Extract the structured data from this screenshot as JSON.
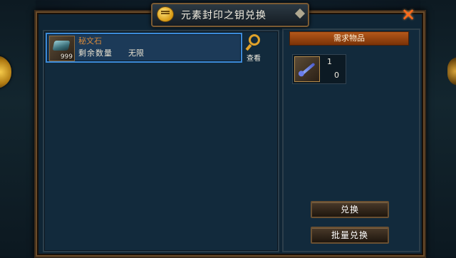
{
  "window": {
    "title": "元素封印之钥兑换",
    "title_icon": "chat-bubble-icon",
    "close_icon": "close-x-icon"
  },
  "exchange_list": [
    {
      "name": "秘文石",
      "count": "999",
      "remain_label": "剩余数量",
      "remain_value": "无限",
      "icon": "rune-stone-icon"
    }
  ],
  "view_button": {
    "label": "查看",
    "icon": "magnifier-icon"
  },
  "required": {
    "header": "需求物品",
    "items": [
      {
        "icon": "blue-key-icon",
        "need": "1",
        "have": "0"
      }
    ]
  },
  "buttons": {
    "exchange": "兑换",
    "batch_exchange": "批量兑换"
  },
  "colors": {
    "accent": "#b4581a",
    "selected_border": "#3c8ad8",
    "close": "#ff6a1a",
    "item_name": "#d88a3a"
  }
}
